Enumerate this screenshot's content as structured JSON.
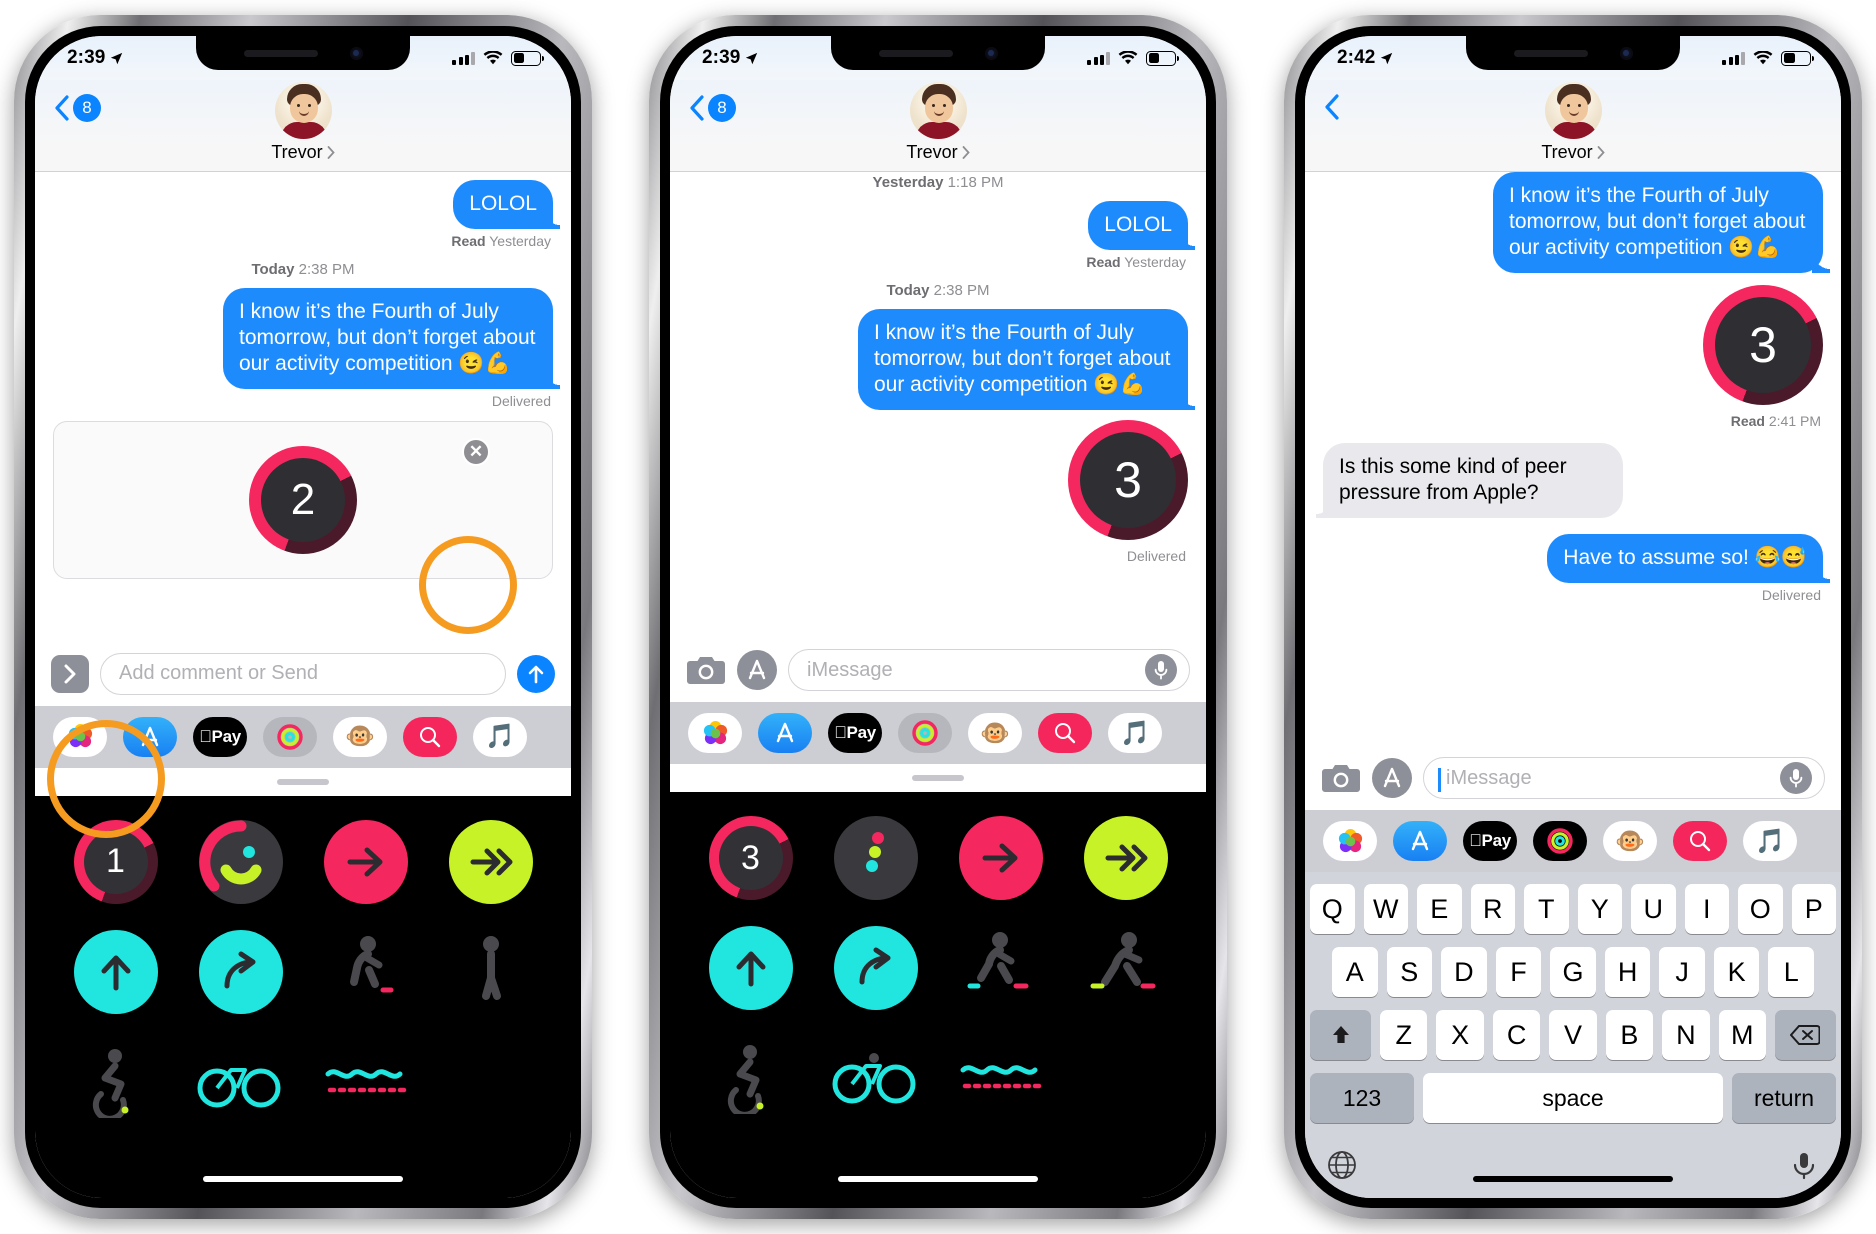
{
  "app": {
    "name": "Messages",
    "contact_name": "Trevor"
  },
  "phones": [
    {
      "id": "phone-1",
      "status": {
        "time": "2:39",
        "location_icon": "location-arrow-icon",
        "signal_icon": "cellular-bars-icon",
        "wifi_icon": "wifi-icon",
        "battery_icon": "battery-icon"
      },
      "nav": {
        "back_badge": "8",
        "back_icon": "chevron-left-icon",
        "title": "Trevor",
        "disclosure_icon": "chevron-right-icon",
        "avatar": "contact-avatar"
      },
      "messages": [
        {
          "kind": "bubble",
          "side": "out",
          "text": "LOLOL"
        },
        {
          "kind": "receipt",
          "label": "Read",
          "value": "Yesterday"
        },
        {
          "kind": "stamp",
          "label": "Today",
          "value": "2:38 PM"
        },
        {
          "kind": "bubble",
          "side": "out",
          "text": "I know it’s the Fourth of July tomorrow, but don’t forget about our activity competition 😉💪"
        },
        {
          "kind": "receipt",
          "label": "",
          "value": "Delivered"
        }
      ],
      "attachment_preview": {
        "ring_value": "2",
        "close_icon": "close-circle-icon"
      },
      "input": {
        "placeholder": "Add comment or Send",
        "expand_icon": "chevron-right-icon",
        "send_icon": "send-arrow-up-icon",
        "send_highlighted": true
      },
      "app_drawer": [
        "photos-icon",
        "app-store-icon",
        "apple-pay-icon",
        "activity-rings-icon",
        "memoji-icon",
        "gif-search-icon",
        "music-icon"
      ],
      "sticker_panel": {
        "visible": true,
        "rows": [
          [
            {
              "type": "ring-number",
              "value": "1",
              "highlighted": true
            },
            {
              "type": "move-rings"
            },
            {
              "type": "arrow-right",
              "color": "#f5275f"
            },
            {
              "type": "arrow-double",
              "color": "#c6f227"
            }
          ],
          [
            {
              "type": "arrow-up",
              "color": "#21e6e0"
            },
            {
              "type": "arrow-curve",
              "color": "#21e6e0"
            },
            {
              "type": "walker"
            },
            {
              "type": "stand"
            }
          ],
          [
            {
              "type": "wheelchair"
            },
            {
              "type": "cycling"
            },
            {
              "type": "swimming"
            },
            {
              "type": "blank"
            }
          ]
        ]
      }
    },
    {
      "id": "phone-2",
      "status": {
        "time": "2:39",
        "location_icon": "location-arrow-icon",
        "signal_icon": "cellular-bars-icon",
        "wifi_icon": "wifi-icon",
        "battery_icon": "battery-icon"
      },
      "nav": {
        "back_badge": "8",
        "back_icon": "chevron-left-icon",
        "title": "Trevor",
        "disclosure_icon": "chevron-right-icon",
        "avatar": "contact-avatar"
      },
      "messages": [
        {
          "kind": "stamp",
          "label": "Yesterday",
          "value": "1:18 PM"
        },
        {
          "kind": "bubble",
          "side": "out",
          "text": "LOLOL"
        },
        {
          "kind": "receipt",
          "label": "Read",
          "value": "Yesterday"
        },
        {
          "kind": "stamp",
          "label": "Today",
          "value": "2:38 PM"
        },
        {
          "kind": "bubble",
          "side": "out",
          "text": "I know it’s the Fourth of July tomorrow, but don’t forget about our activity competition 😉💪"
        },
        {
          "kind": "sticker",
          "side": "out",
          "ring_value": "3"
        },
        {
          "kind": "receipt",
          "label": "",
          "value": "Delivered"
        }
      ],
      "input": {
        "placeholder": "iMessage",
        "camera_icon": "camera-icon",
        "app_store_icon": "app-store-icon",
        "mic_icon": "microphone-icon"
      },
      "app_drawer": [
        "photos-icon",
        "app-store-icon",
        "apple-pay-icon",
        "activity-rings-icon",
        "memoji-icon",
        "gif-search-icon",
        "music-icon"
      ],
      "sticker_panel": {
        "visible": true,
        "rows": [
          [
            {
              "type": "ring-number",
              "value": "3",
              "highlighted": false
            },
            {
              "type": "dots-three"
            },
            {
              "type": "arrow-right",
              "color": "#f5275f"
            },
            {
              "type": "arrow-double",
              "color": "#c6f227"
            }
          ],
          [
            {
              "type": "arrow-up",
              "color": "#21e6e0"
            },
            {
              "type": "arrow-curve",
              "color": "#21e6e0"
            },
            {
              "type": "walker"
            },
            {
              "type": "runner"
            }
          ],
          [
            {
              "type": "wheelchair"
            },
            {
              "type": "cycling"
            },
            {
              "type": "swimming"
            },
            {
              "type": "blank"
            }
          ]
        ]
      }
    },
    {
      "id": "phone-3",
      "status": {
        "time": "2:42",
        "location_icon": "location-arrow-icon",
        "signal_icon": "cellular-bars-icon",
        "wifi_icon": "wifi-icon",
        "battery_icon": "battery-icon"
      },
      "nav": {
        "back_badge": "",
        "back_icon": "chevron-left-icon",
        "title": "Trevor",
        "disclosure_icon": "chevron-right-icon",
        "avatar": "contact-avatar"
      },
      "messages": [
        {
          "kind": "bubble",
          "side": "out",
          "text": "I know it’s the Fourth of July tomorrow, but don’t forget about our activity competition 😉💪"
        },
        {
          "kind": "sticker",
          "side": "out",
          "ring_value": "3"
        },
        {
          "kind": "receipt",
          "label": "Read",
          "value": "2:41 PM"
        },
        {
          "kind": "bubble",
          "side": "in",
          "text": "Is this some kind of peer pressure from Apple?"
        },
        {
          "kind": "bubble",
          "side": "out",
          "text": "Have to assume so! 😂😅"
        },
        {
          "kind": "receipt",
          "label": "",
          "value": "Delivered"
        }
      ],
      "input": {
        "placeholder": "iMessage",
        "camera_icon": "camera-icon",
        "app_store_icon": "app-store-icon",
        "mic_icon": "microphone-icon",
        "caret": true
      },
      "app_drawer": [
        "photos-icon",
        "app-store-icon",
        "apple-pay-icon",
        "activity-rings-icon",
        "memoji-icon",
        "gif-search-icon",
        "music-icon"
      ],
      "keyboard": {
        "row1": [
          "Q",
          "W",
          "E",
          "R",
          "T",
          "Y",
          "U",
          "I",
          "O",
          "P"
        ],
        "row2": [
          "A",
          "S",
          "D",
          "F",
          "G",
          "H",
          "J",
          "K",
          "L"
        ],
        "row3": [
          "Z",
          "X",
          "C",
          "V",
          "B",
          "N",
          "M"
        ],
        "shift_icon": "shift-up-icon",
        "backspace_icon": "backspace-icon",
        "numbers_key": "123",
        "space_key": "space",
        "return_key": "return",
        "globe_icon": "globe-icon",
        "dictation_icon": "microphone-icon"
      }
    }
  ],
  "colors": {
    "imessage_blue": "#1e8bfd",
    "tint_blue": "#0a84ff",
    "incoming_gray": "#e8e8ed",
    "highlight_orange": "#f59b20",
    "ring_pink": "#f5275f",
    "ring_green": "#c6f227",
    "ring_cyan": "#21e6e0",
    "secondary_text": "#8e8e93"
  }
}
